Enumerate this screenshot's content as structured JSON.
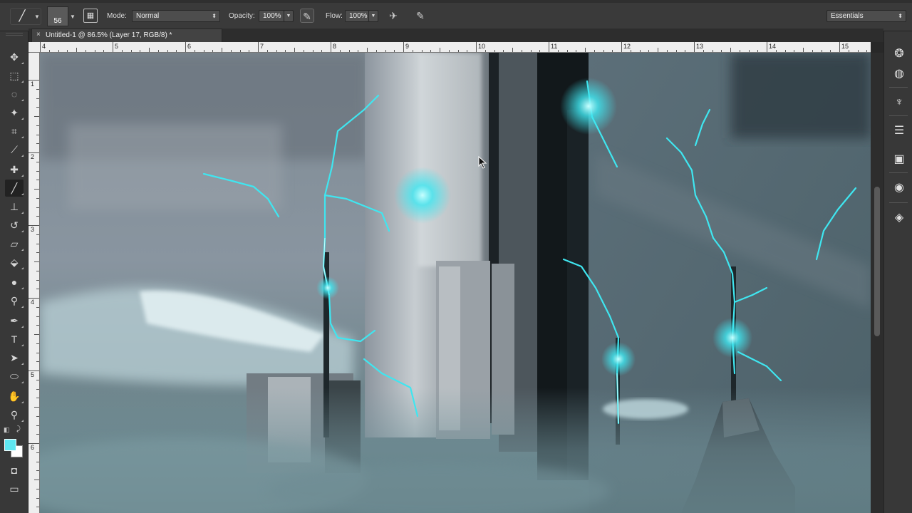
{
  "options_bar": {
    "brush_size": "56",
    "mode_label": "Mode:",
    "mode_value": "Normal",
    "opacity_label": "Opacity:",
    "opacity_value": "100%",
    "flow_label": "Flow:",
    "flow_value": "100%",
    "workspace_value": "Essentials",
    "icons": [
      "brush-tool-icon",
      "brush-panel-icon",
      "pressure-opacity-icon",
      "airbrush-icon",
      "pressure-size-icon"
    ]
  },
  "document": {
    "tab_close": "×",
    "tab_title": "Untitled-1 @ 86.5% (Layer 17, RGB/8) *"
  },
  "rulers": {
    "horizontal": [
      "4",
      "5",
      "6",
      "7",
      "8",
      "9",
      "10",
      "11",
      "12",
      "13",
      "14",
      "15"
    ],
    "vertical": [
      "1",
      "2",
      "3",
      "4",
      "5",
      "6"
    ]
  },
  "colors": {
    "foreground": "#5fe7f1",
    "background": "#ffffff",
    "ui_dark": "#383838"
  },
  "tools": [
    {
      "name": "move-tool-icon",
      "glyph": "✥"
    },
    {
      "name": "marquee-tool-icon",
      "glyph": "⬚"
    },
    {
      "name": "lasso-tool-icon",
      "glyph": "◌"
    },
    {
      "name": "quick-selection-tool-icon",
      "glyph": "✦"
    },
    {
      "name": "crop-tool-icon",
      "glyph": "⌗"
    },
    {
      "name": "eyedropper-tool-icon",
      "glyph": "⟋"
    },
    {
      "name": "healing-brush-tool-icon",
      "glyph": "✚"
    },
    {
      "name": "brush-tool-icon",
      "glyph": "╱"
    },
    {
      "name": "clone-stamp-tool-icon",
      "glyph": "⊥"
    },
    {
      "name": "history-brush-tool-icon",
      "glyph": "↺"
    },
    {
      "name": "eraser-tool-icon",
      "glyph": "▱"
    },
    {
      "name": "paint-bucket-tool-icon",
      "glyph": "⬙"
    },
    {
      "name": "blur-tool-icon",
      "glyph": "●"
    },
    {
      "name": "dodge-tool-icon",
      "glyph": "⚲"
    },
    {
      "name": "pen-tool-icon",
      "glyph": "✒"
    },
    {
      "name": "type-tool-icon",
      "glyph": "T"
    },
    {
      "name": "path-selection-tool-icon",
      "glyph": "➤"
    },
    {
      "name": "ellipse-tool-icon",
      "glyph": "⬭"
    },
    {
      "name": "hand-tool-icon",
      "glyph": "✋"
    },
    {
      "name": "zoom-tool-icon",
      "glyph": "⚲"
    }
  ],
  "bottom_tools": [
    {
      "name": "quick-mask-icon",
      "glyph": "◘"
    },
    {
      "name": "screen-mode-icon",
      "glyph": "▭"
    }
  ],
  "right_panels": [
    {
      "name": "navigator-panel-icon",
      "glyph": "❂"
    },
    {
      "name": "color-panel-icon",
      "glyph": "◍"
    },
    {
      "name": "brush-presets-panel-icon",
      "glyph": "♆"
    },
    {
      "name": "adjustments-panel-icon",
      "glyph": "☰"
    },
    {
      "name": "styles-panel-icon",
      "glyph": "▣"
    },
    {
      "name": "channels-panel-icon",
      "glyph": "◉"
    },
    {
      "name": "layers-panel-icon",
      "glyph": "◈"
    }
  ]
}
